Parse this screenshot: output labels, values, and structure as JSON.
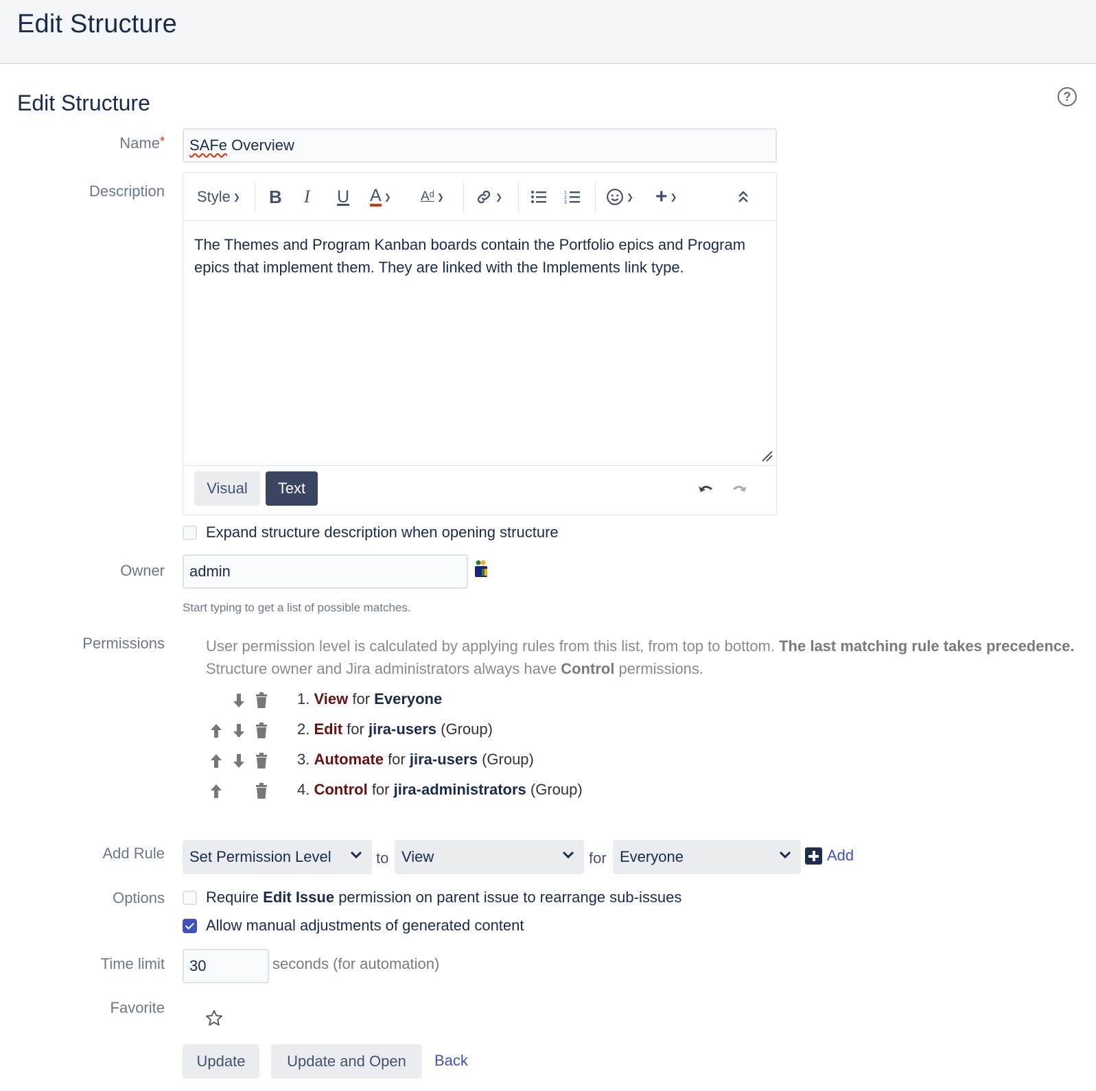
{
  "header": {
    "title": "Edit Structure"
  },
  "page": {
    "title": "Edit Structure",
    "help_icon": "question-circle-icon"
  },
  "name": {
    "label": "Name",
    "required_mark": "*",
    "value": "SAFe Overview"
  },
  "description": {
    "label": "Description",
    "toolbar": {
      "style_label": "Style",
      "buttons": [
        "bold",
        "italic",
        "underline",
        "text-color",
        "text-formatting",
        "link",
        "bullet-list",
        "numbered-list",
        "emoji",
        "insert",
        "collapse-toolbar"
      ]
    },
    "text": "The Themes and Program Kanban boards contain the Portfolio epics and Program epics that implement them. They are linked with the Implements link type.",
    "mode_tabs": {
      "visual": "Visual",
      "text": "Text",
      "active": "Text"
    }
  },
  "expand_description": {
    "label": "Expand structure description when opening structure",
    "checked": false
  },
  "owner": {
    "label": "Owner",
    "value": "admin",
    "hint": "Start typing to get a list of possible matches."
  },
  "permissions": {
    "label": "Permissions",
    "intro_1": "User permission level is calculated by applying rules from this list, from top to bottom. ",
    "intro_bold": "The last matching rule takes precedence.",
    "intro_2": " Structure owner and Jira administrators always have ",
    "intro_bold2": "Control",
    "intro_3": " permissions.",
    "connector": "for",
    "rules": [
      {
        "num": "1.",
        "level": "View",
        "subject": "Everyone",
        "suffix": "",
        "can_up": false,
        "can_down": true
      },
      {
        "num": "2.",
        "level": "Edit",
        "subject": "jira-users",
        "suffix": "(Group)",
        "can_up": true,
        "can_down": true
      },
      {
        "num": "3.",
        "level": "Automate",
        "subject": "jira-users",
        "suffix": "(Group)",
        "can_up": true,
        "can_down": true
      },
      {
        "num": "4.",
        "level": "Control",
        "subject": "jira-administrators",
        "suffix": "(Group)",
        "can_up": true,
        "can_down": false
      }
    ]
  },
  "add_rule": {
    "label": "Add Rule",
    "action": "Set Permission Level",
    "to": "to",
    "level": "View",
    "for": "for",
    "subject": "Everyone",
    "add_label": "Add"
  },
  "options": {
    "label": "Options",
    "require_pre": "Require ",
    "require_bold": "Edit Issue",
    "require_post": " permission on parent issue to rearrange sub-issues",
    "require_checked": false,
    "allow_manual": "Allow manual adjustments of generated content",
    "allow_manual_checked": true
  },
  "time_limit": {
    "label": "Time limit",
    "value": "30",
    "unit": "seconds (for automation)"
  },
  "favorite": {
    "label": "Favorite",
    "starred": false
  },
  "actions": {
    "update": "Update",
    "update_open": "Update and Open",
    "back": "Back"
  },
  "colors": {
    "accent": "#3f51c0",
    "level_text": "#6b0f0f",
    "active_tab": "#3b4562",
    "text": "#172b4d"
  }
}
